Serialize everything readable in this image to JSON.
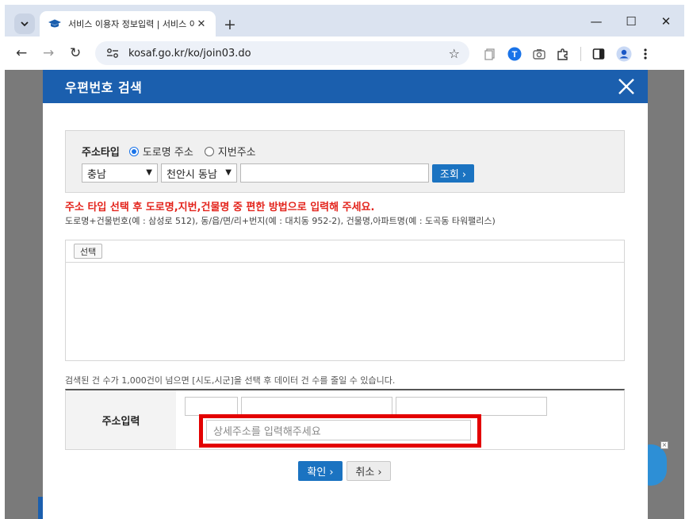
{
  "browser": {
    "tab_title": "서비스 이용자 정보입력 | 서비스 이용",
    "url": "kosaf.go.kr/ko/join03.do",
    "new_tab_symbol": "+",
    "tab_close_symbol": "✕",
    "window_controls": {
      "minimize": "—",
      "maximize": "☐",
      "close": "✕"
    }
  },
  "modal": {
    "title": "우편번호 검색",
    "search": {
      "type_label": "주소타입",
      "options": [
        "도로명 주소",
        "지번주소"
      ],
      "selected_option": "도로명 주소",
      "province_value": "충남",
      "city_value": "천안시 동남",
      "keyword_value": "",
      "search_button": "조회 ›"
    },
    "notice": "주소 타입 선택 후 도로명,지번,건물명 중 편한 방법으로 입력해 주세요.",
    "example": "도로명+건물번호(예 : 삼성로 512), 동/읍/면/리+번지(예 : 대치동 952-2), 건물명,아파트명(예 : 도곡동 타워팰리스)",
    "result": {
      "select_button": "선택"
    },
    "hint": "검색된 건 수가 1,000건이 넘으면 [시도,시군]을 선택 후 데이터 건 수를 줄일 수 있습니다.",
    "address": {
      "label": "주소입력",
      "zip_value": "",
      "road_value": "",
      "extra_value": "",
      "detail_placeholder": "상세주소를 입력해주세요"
    },
    "buttons": {
      "ok": "확인 ›",
      "cancel": "취소 ›"
    }
  },
  "colors": {
    "header": "#1b5fae",
    "button_blue": "#1b73c1",
    "notice_red": "#e3231b",
    "highlight": "#e30000"
  }
}
